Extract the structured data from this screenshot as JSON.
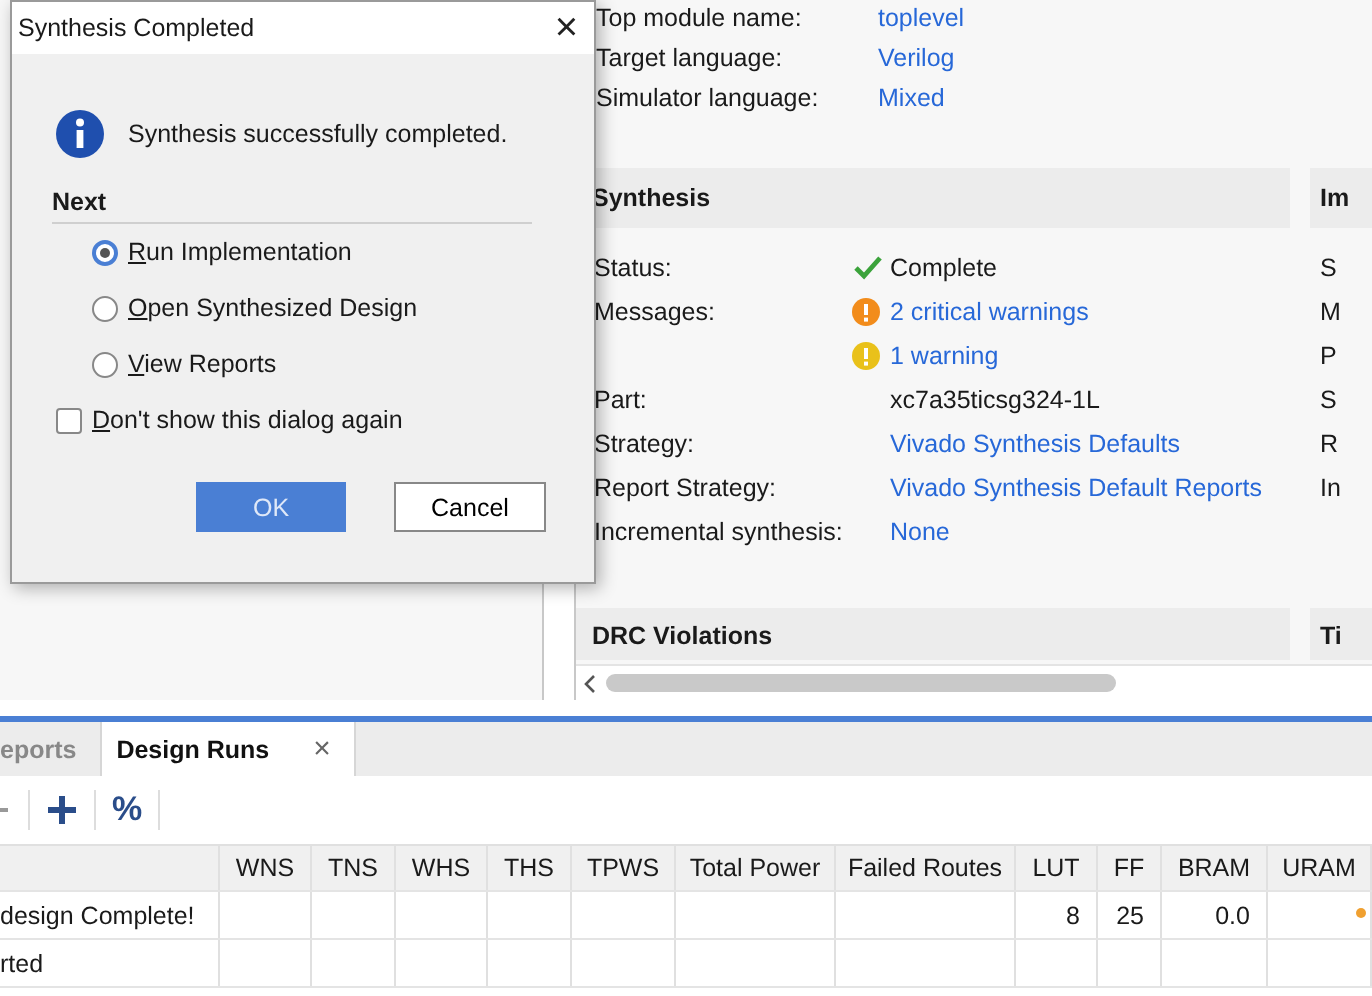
{
  "project_summary": {
    "rows": [
      {
        "label": "Top module name:",
        "value": "toplevel"
      },
      {
        "label": "Target language:",
        "value": "Verilog"
      },
      {
        "label": "Simulator language:",
        "value": "Mixed"
      }
    ]
  },
  "synthesis": {
    "title": "Synthesis",
    "rows": [
      {
        "label": "Status:",
        "value": "Complete",
        "kind": "success",
        "link": false
      },
      {
        "label": "Messages:",
        "value": "2 critical warnings",
        "kind": "critical",
        "link": true
      },
      {
        "value": "1 warning",
        "kind": "warning",
        "link": true
      },
      {
        "label": "Part:",
        "value": "xc7a35ticsg324-1L",
        "link": false
      },
      {
        "label": "Strategy:",
        "value": "Vivado Synthesis Defaults",
        "link": true
      },
      {
        "label": "Report Strategy:",
        "value": "Vivado Synthesis Default Reports",
        "link": true
      },
      {
        "label": "Incremental synthesis:",
        "value": "None",
        "link": true
      }
    ]
  },
  "implementation": {
    "title": "Im",
    "row_labels": [
      "S",
      "M",
      "P",
      "S",
      "R",
      "In"
    ]
  },
  "drc": {
    "title": "DRC Violations"
  },
  "timing": {
    "title": "Ti"
  },
  "bottom_tabs": [
    {
      "label": "eports",
      "selected": false,
      "closable": false
    },
    {
      "label": "Design Runs",
      "selected": true,
      "closable": true,
      "close": "×"
    }
  ],
  "toolbar": {
    "percent": "%"
  },
  "table": {
    "columns": [
      {},
      {
        "label": "WNS"
      },
      {
        "label": "TNS"
      },
      {
        "label": "WHS"
      },
      {
        "label": "THS"
      },
      {
        "label": "TPWS"
      },
      {
        "label": "Total Power"
      },
      {
        "label": "Failed Routes"
      },
      {
        "label": "LUT"
      },
      {
        "label": "FF"
      },
      {
        "label": "BRAM"
      },
      {
        "label": "URAM"
      }
    ],
    "rows": [
      {
        "cells": [
          "design Complete!",
          null,
          null,
          null,
          null,
          null,
          null,
          null,
          "8",
          "25",
          "0.0",
          null
        ],
        "marker": true
      },
      {
        "cells": [
          "rted",
          null,
          null,
          null,
          null,
          null,
          null,
          null,
          null,
          null,
          null,
          null
        ],
        "marker": false
      }
    ]
  },
  "dialog": {
    "title": "Synthesis Completed",
    "close": "×",
    "message": "Synthesis successfully completed.",
    "section": "Next",
    "options": [
      {
        "label": "Run Implementation",
        "selected": true
      },
      {
        "label": "Open Synthesized Design",
        "selected": false
      },
      {
        "label": "View Reports",
        "selected": false
      }
    ],
    "dont_show": {
      "label": "Don't show this dialog again",
      "checked": false
    },
    "buttons": [
      {
        "label": "OK",
        "kind": "primary"
      },
      {
        "label": "Cancel",
        "kind": "secondary"
      }
    ]
  }
}
